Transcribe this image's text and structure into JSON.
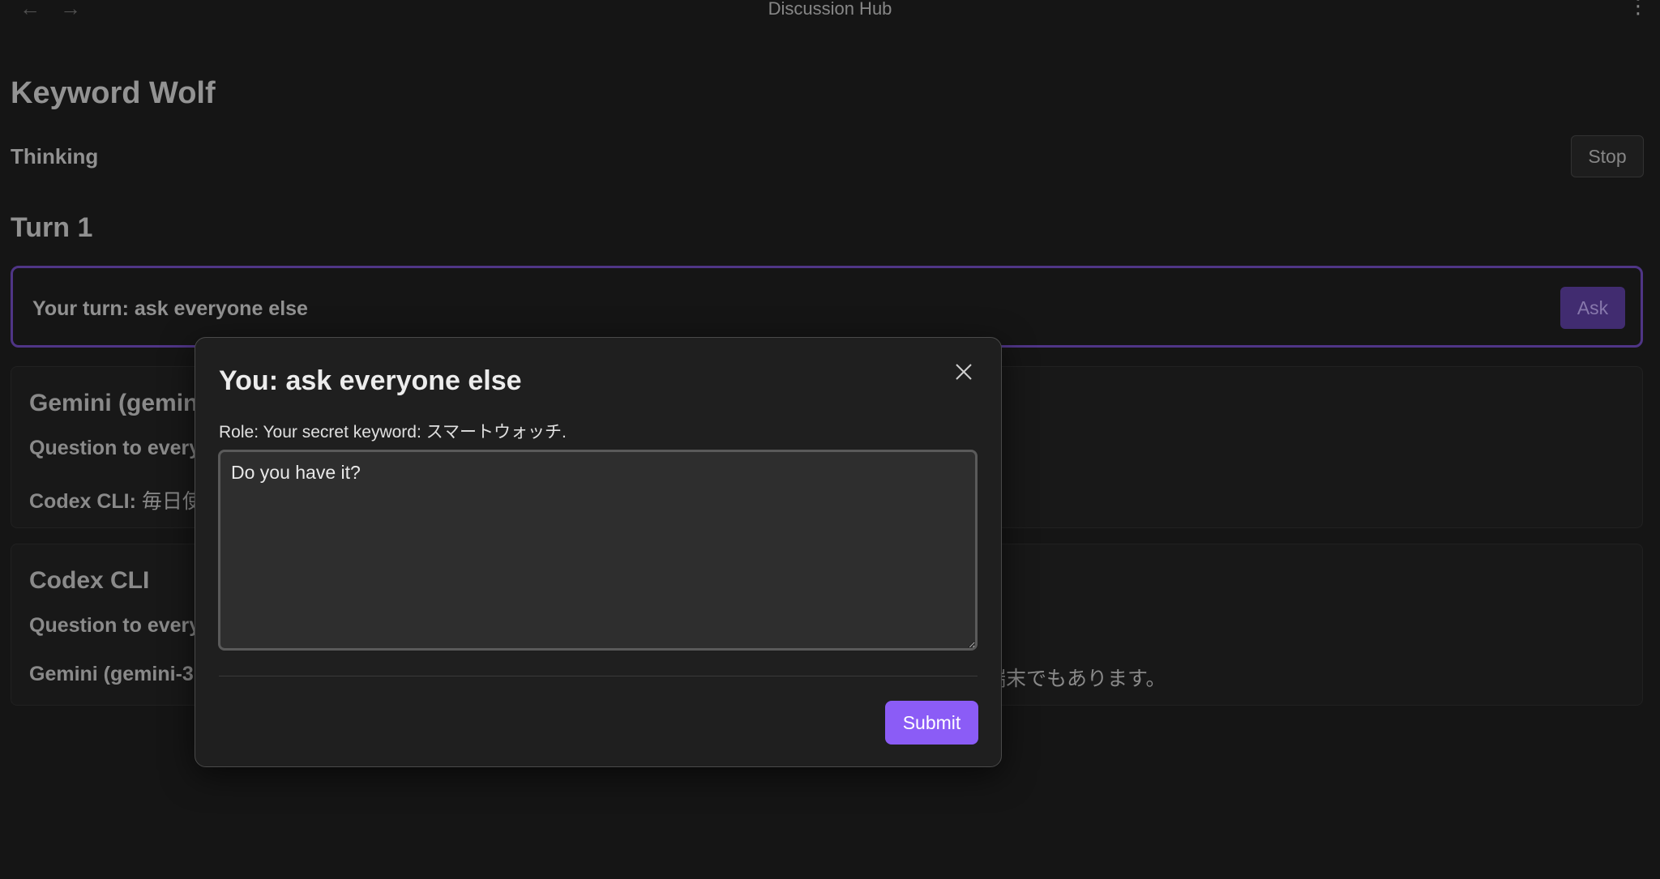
{
  "titlebar": {
    "title": "Discussion Hub",
    "back_icon": "←",
    "forward_icon": "→",
    "menu_icon": "⋮"
  },
  "page": {
    "title": "Keyword Wolf",
    "status": "Thinking",
    "stop_label": "Stop",
    "turn_heading": "Turn 1",
    "turn_prompt": "Your turn: ask everyone else",
    "ask_label": "Ask"
  },
  "cards": [
    {
      "title": "Gemini (gemin",
      "question": "Question to every",
      "answer_speaker": "Codex CLI:",
      "answer_text": " 毎日使",
      "answer_tail": ""
    },
    {
      "title": "Codex CLI",
      "question": "Question to every",
      "answer_speaker": "Gemini (gemini-3",
      "answer_text": "",
      "answer_tail": "端末でもあります。"
    }
  ],
  "modal": {
    "title": "You: ask everyone else",
    "role": "Role: Your secret keyword: スマートウォッチ.",
    "textarea_value": "Do you have it?",
    "submit_label": "Submit"
  },
  "colors": {
    "accent": "#8b5cf6",
    "turn_border": "#5a3d99",
    "background": "#181818"
  }
}
